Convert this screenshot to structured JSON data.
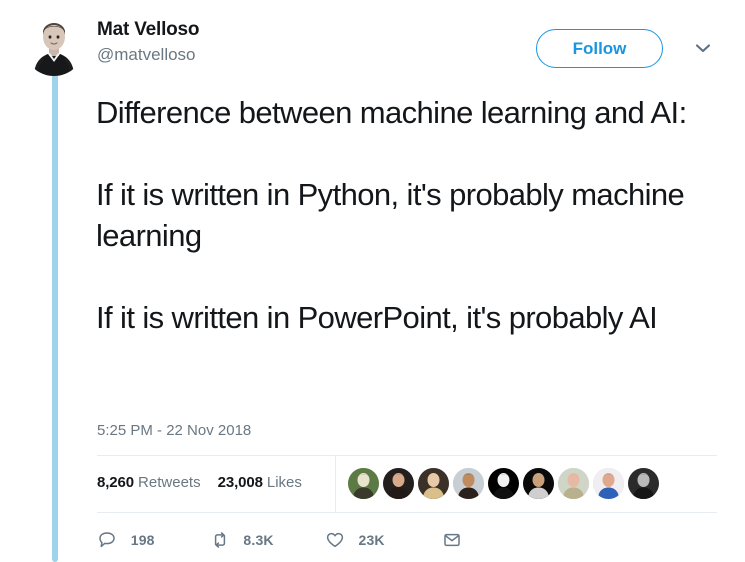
{
  "tweet": {
    "author": {
      "display_name": "Mat Velloso",
      "handle": "@matvelloso",
      "avatar_icon": "user-photo-avatar"
    },
    "follow_label": "Follow",
    "more_icon": "chevron-down-icon",
    "body": "Difference between machine learning and AI:\n\nIf it is written in Python, it's probably machine learning\n\nIf it is written in PowerPoint, it's probably AI",
    "timestamp": "5:25 PM - 22 Nov 2018",
    "stats": {
      "retweets_count": "8,260",
      "retweets_label": "Retweets",
      "likes_count": "23,008",
      "likes_label": "Likes"
    },
    "liker_avatars": [
      {
        "name": "liker-avatar-1",
        "bg": "#5c7a43",
        "skin": "#e8e2cf",
        "hair": "#3a3a2c"
      },
      {
        "name": "liker-avatar-2",
        "bg": "#231f1c",
        "skin": "#d8a98a",
        "hair": "#221a16"
      },
      {
        "name": "liker-avatar-3",
        "bg": "#3b3128",
        "skin": "#e7c9a8",
        "hair": "#d9c08a"
      },
      {
        "name": "liker-avatar-4",
        "bg": "#c8cfd4",
        "skin": "#c08b5e",
        "hair": "#2a211c"
      },
      {
        "name": "liker-avatar-5",
        "bg": "#000000",
        "skin": "#f1f1f1",
        "hair": "#111111"
      },
      {
        "name": "liker-avatar-6",
        "bg": "#0a0a0a",
        "skin": "#c9a07a",
        "hair": "#cfcfcf"
      },
      {
        "name": "liker-avatar-7",
        "bg": "#cfd6c7",
        "skin": "#e7b9a4",
        "hair": "#b9b08e"
      },
      {
        "name": "liker-avatar-8",
        "bg": "#f0eef0",
        "skin": "#e0a98d",
        "hair": "#2d62b8"
      },
      {
        "name": "liker-avatar-9",
        "bg": "#2b2b2b",
        "skin": "#b9b9b9",
        "hair": "#161616"
      }
    ],
    "actions": {
      "reply": {
        "icon": "reply-icon",
        "count": "198"
      },
      "retweet": {
        "icon": "retweet-icon",
        "count": "8.3K"
      },
      "like": {
        "icon": "heart-icon",
        "count": "23K"
      },
      "direct_message": {
        "icon": "envelope-icon"
      }
    }
  },
  "colors": {
    "twitter_blue": "#1b95e0",
    "thread_line": "#9fd3ec",
    "text_primary": "#14171a",
    "text_secondary": "#697882",
    "action_gray": "#667786",
    "divider": "#e6ecf0"
  }
}
